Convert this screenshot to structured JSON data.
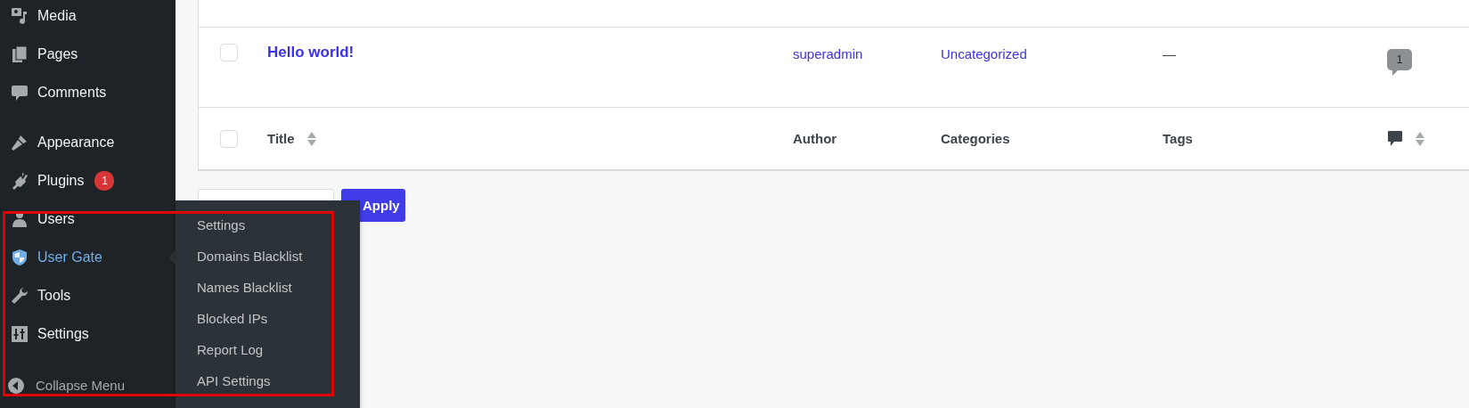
{
  "sidebar": {
    "groups": [
      [
        {
          "label": "Media",
          "kind": "media",
          "selected": false
        },
        {
          "label": "Pages",
          "kind": "pages",
          "selected": false
        },
        {
          "label": "Comments",
          "kind": "comments",
          "selected": false
        }
      ],
      [
        {
          "label": "Appearance",
          "kind": "appearance",
          "selected": false
        },
        {
          "label": "Plugins",
          "kind": "plugins",
          "selected": false,
          "badge": "1"
        },
        {
          "label": "Users",
          "kind": "users",
          "selected": false
        },
        {
          "label": "User Gate",
          "kind": "shield",
          "selected": true
        },
        {
          "label": "Tools",
          "kind": "tools",
          "selected": false
        },
        {
          "label": "Settings",
          "kind": "settings",
          "selected": false
        }
      ]
    ],
    "collapse": "Collapse Menu"
  },
  "flyout": {
    "items": [
      "Settings",
      "Domains Blacklist",
      "Names Blacklist",
      "Blocked IPs",
      "Report Log",
      "API Settings"
    ]
  },
  "table": {
    "rows": [
      {
        "checked": false,
        "title": "Hello world!",
        "author": "superadmin",
        "categories": "Uncategorized",
        "tags": "—",
        "comments": "1"
      }
    ],
    "footer": {
      "checked": false,
      "columns": [
        "Title",
        "Author",
        "Categories",
        "Tags"
      ]
    }
  },
  "bulk": {
    "apply": "Apply"
  }
}
